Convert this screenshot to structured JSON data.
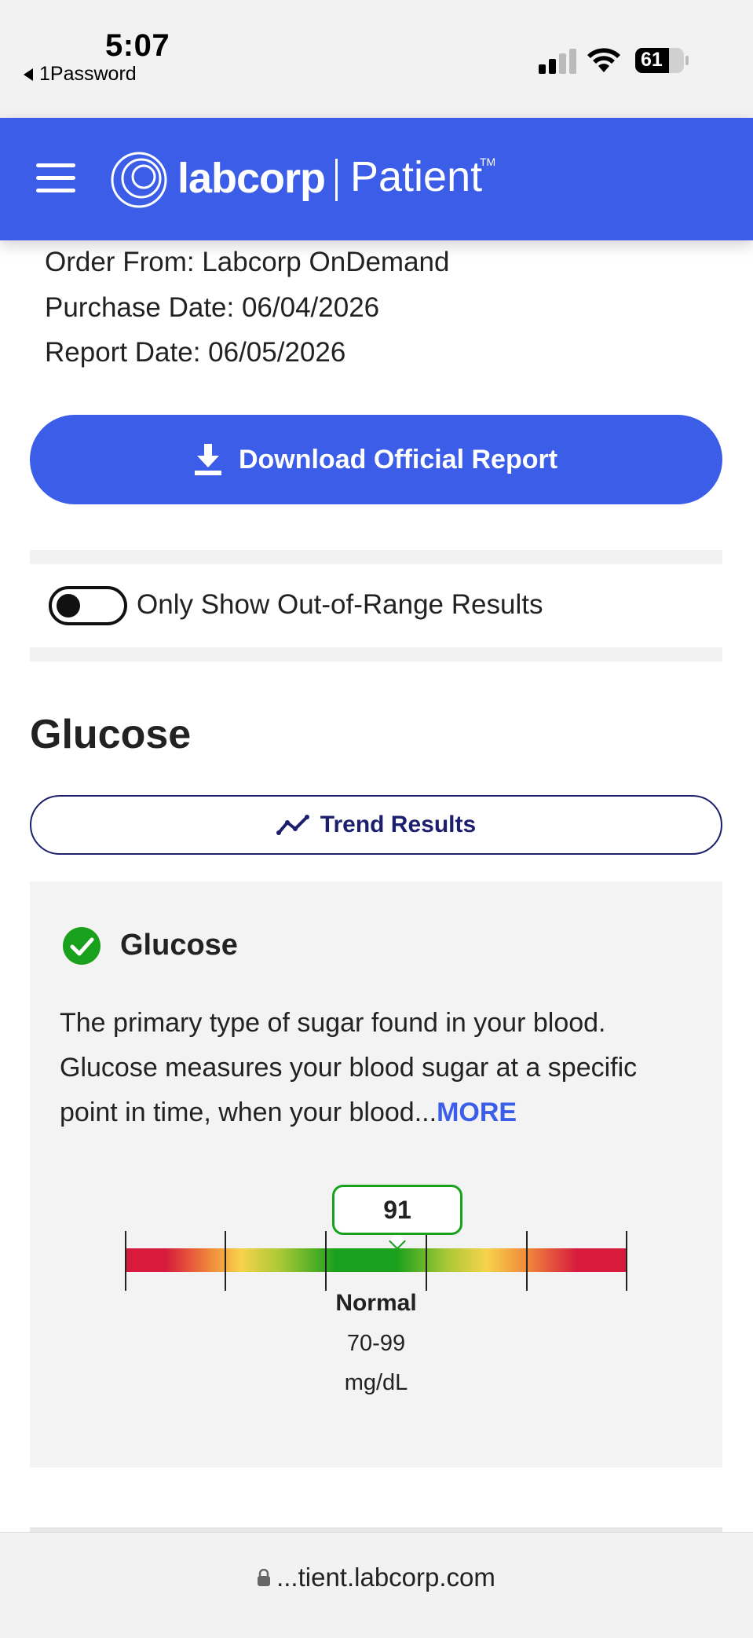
{
  "status_bar": {
    "time": "5:07",
    "back_app": "1Password",
    "battery": "61",
    "icons": [
      "signal-icon",
      "wifi-icon",
      "battery-icon"
    ]
  },
  "header": {
    "brand": "labcorp",
    "brand_sub": "Patient",
    "trademark": "TM",
    "icons": [
      "menu-icon",
      "labcorp-logo-icon"
    ]
  },
  "order_info": {
    "order_from": "Order From: Labcorp OnDemand",
    "purchase_date": "Purchase Date: 06/04/2026",
    "report_date": "Report Date: 06/05/2026"
  },
  "download_button": {
    "label": "Download Official Report",
    "icon": "download-icon"
  },
  "filter": {
    "toggle_label": "Only Show Out-of-Range Results",
    "toggle_on": false
  },
  "section": {
    "title": "Glucose",
    "trend_label": "Trend Results",
    "trend_icon": "trend-line-icon"
  },
  "result_card": {
    "title": "Glucose",
    "status_icon": "check-circle-icon",
    "description": "The primary type of sugar found in your blood. Glucose measures your blood sugar at a specific point in time, when your blood...",
    "more_label": "MORE",
    "value": "91",
    "value_numeric": 91,
    "status": "Normal",
    "range": "70-99",
    "unit": "mg/dL"
  },
  "colors": {
    "brand_blue": "#3b5de7",
    "normal_green": "#19a01c",
    "out_of_range_red": "#d81b3c",
    "trend_navy": "#1c1f6e"
  },
  "url_bar": {
    "url": "...tient.labcorp.com",
    "icon": "lock-icon"
  }
}
